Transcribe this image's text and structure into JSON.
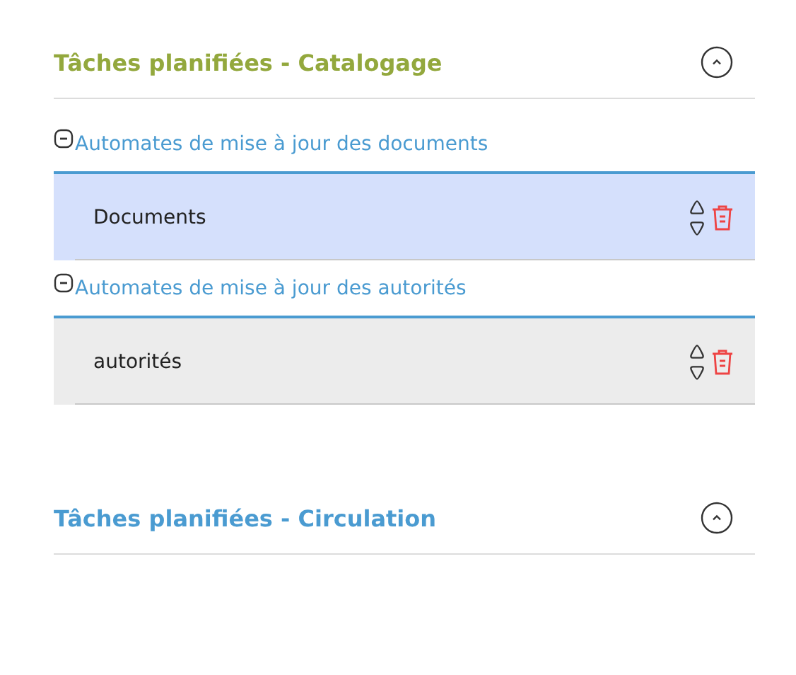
{
  "sections": [
    {
      "title": "Tâches planifiées - Catalogage",
      "active": true,
      "groups": [
        {
          "label": "Automates de mise à jour des documents",
          "expanded": true,
          "rows": [
            {
              "name": "Documents",
              "selected": true
            }
          ]
        },
        {
          "label": "Automates de mise à jour des autorités",
          "expanded": true,
          "rows": [
            {
              "name": "autorités",
              "selected": false
            }
          ]
        }
      ]
    },
    {
      "title": "Tâches planifiées - Circulation",
      "active": false
    }
  ]
}
